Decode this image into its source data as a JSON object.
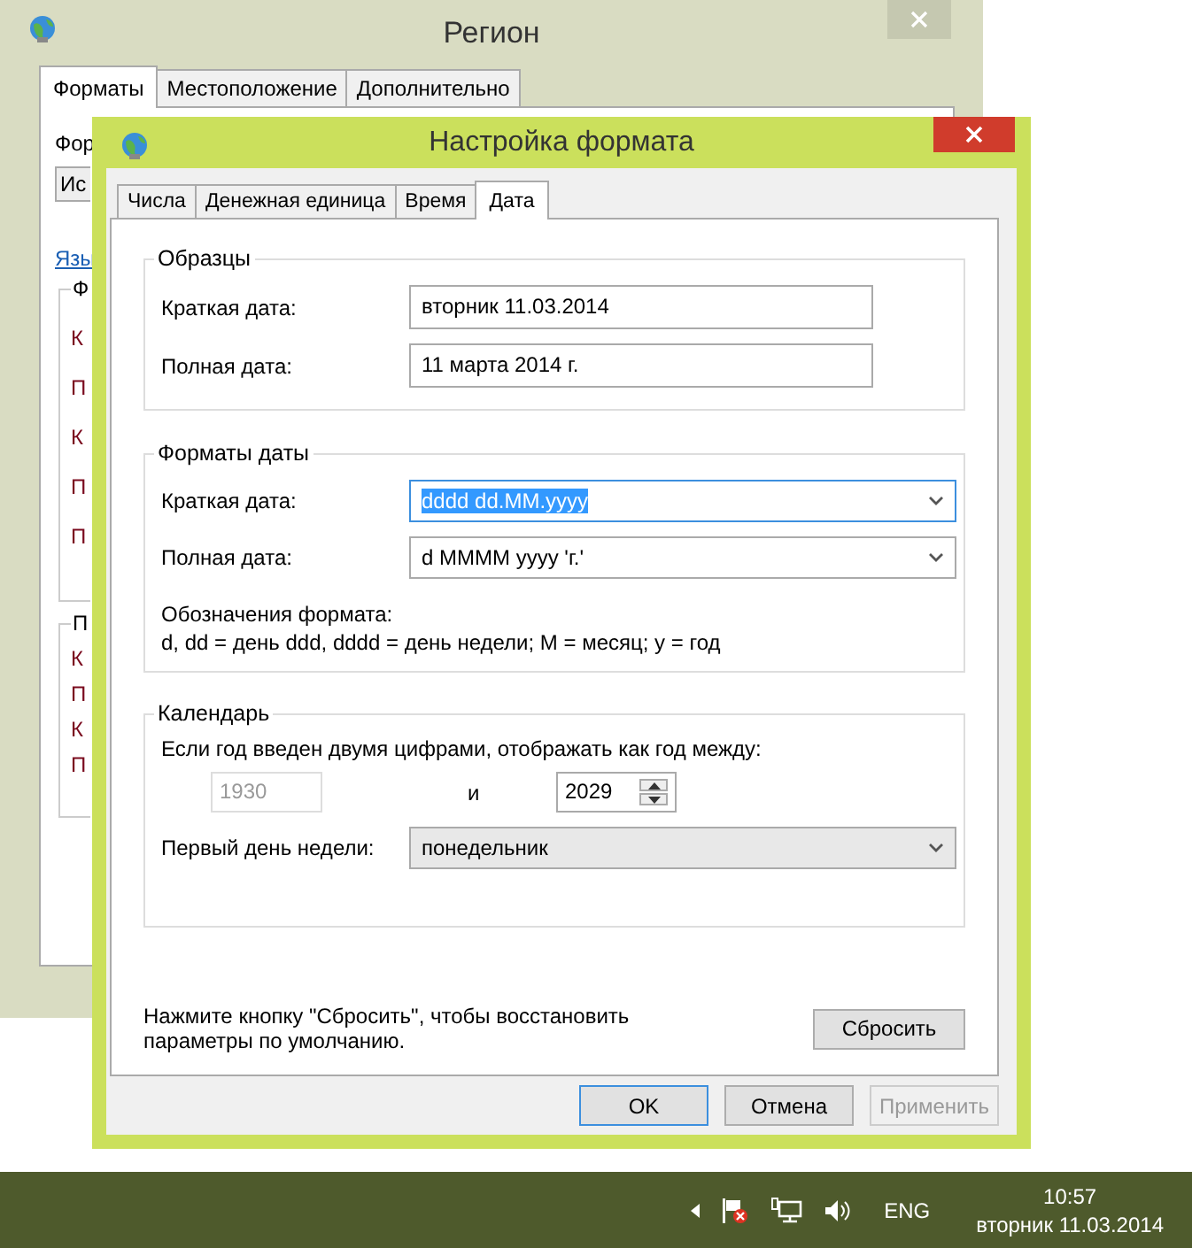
{
  "background_window": {
    "title": "Регион",
    "tabs": [
      {
        "label": "Форматы",
        "selected": true
      },
      {
        "label": "Местоположение",
        "selected": false
      },
      {
        "label": "Дополнительно",
        "selected": false
      }
    ],
    "format_label": "Фор",
    "format_value": "Ис",
    "language_link": "Язы",
    "groups": [
      {
        "title": "Ф",
        "items": [
          "К",
          "П",
          "К",
          "П",
          "П"
        ]
      },
      {
        "title": "П",
        "items": [
          "К",
          "П",
          "К",
          "П"
        ]
      }
    ]
  },
  "dialog": {
    "title": "Настройка формата",
    "tabs": [
      {
        "label": "Числа",
        "selected": false
      },
      {
        "label": "Денежная единица",
        "selected": false
      },
      {
        "label": "Время",
        "selected": false
      },
      {
        "label": "Дата",
        "selected": true
      }
    ],
    "samples": {
      "title": "Образцы",
      "rows": [
        {
          "label": "Краткая дата:",
          "value": "вторник 11.03.2014"
        },
        {
          "label": "Полная дата:",
          "value": "11 марта 2014 г."
        }
      ]
    },
    "date_formats": {
      "title": "Форматы даты",
      "rows": [
        {
          "label": "Краткая дата:",
          "value": "dddd dd.MM.yyyy",
          "focused": true
        },
        {
          "label": "Полная дата:",
          "value": "d MMMM yyyy 'г.'",
          "focused": false
        }
      ],
      "notation_title": "Обозначения формата:",
      "notation": "d, dd = день  ddd, dddd = день недели; M = месяц; y = год"
    },
    "calendar": {
      "title": "Календарь",
      "two_digit_label": "Если год введен двумя цифрами, отображать как год между:",
      "year_from": {
        "value": "1930",
        "disabled": true
      },
      "and": "и",
      "year_to": {
        "value": "2029",
        "disabled": false
      },
      "first_day_label": "Первый день недели:",
      "first_day_value": "понедельник"
    },
    "reset_note": "Нажмите кнопку \"Сбросить\", чтобы восстановить параметры по умолчанию.",
    "reset_button": "Сбросить",
    "buttons": [
      {
        "label": "OK",
        "kind": "default"
      },
      {
        "label": "Отмена",
        "kind": "normal"
      },
      {
        "label": "Применить",
        "kind": "disabled"
      }
    ]
  },
  "taskbar": {
    "language": "ENG",
    "time": "10:57",
    "date": "вторник 11.03.2014"
  }
}
